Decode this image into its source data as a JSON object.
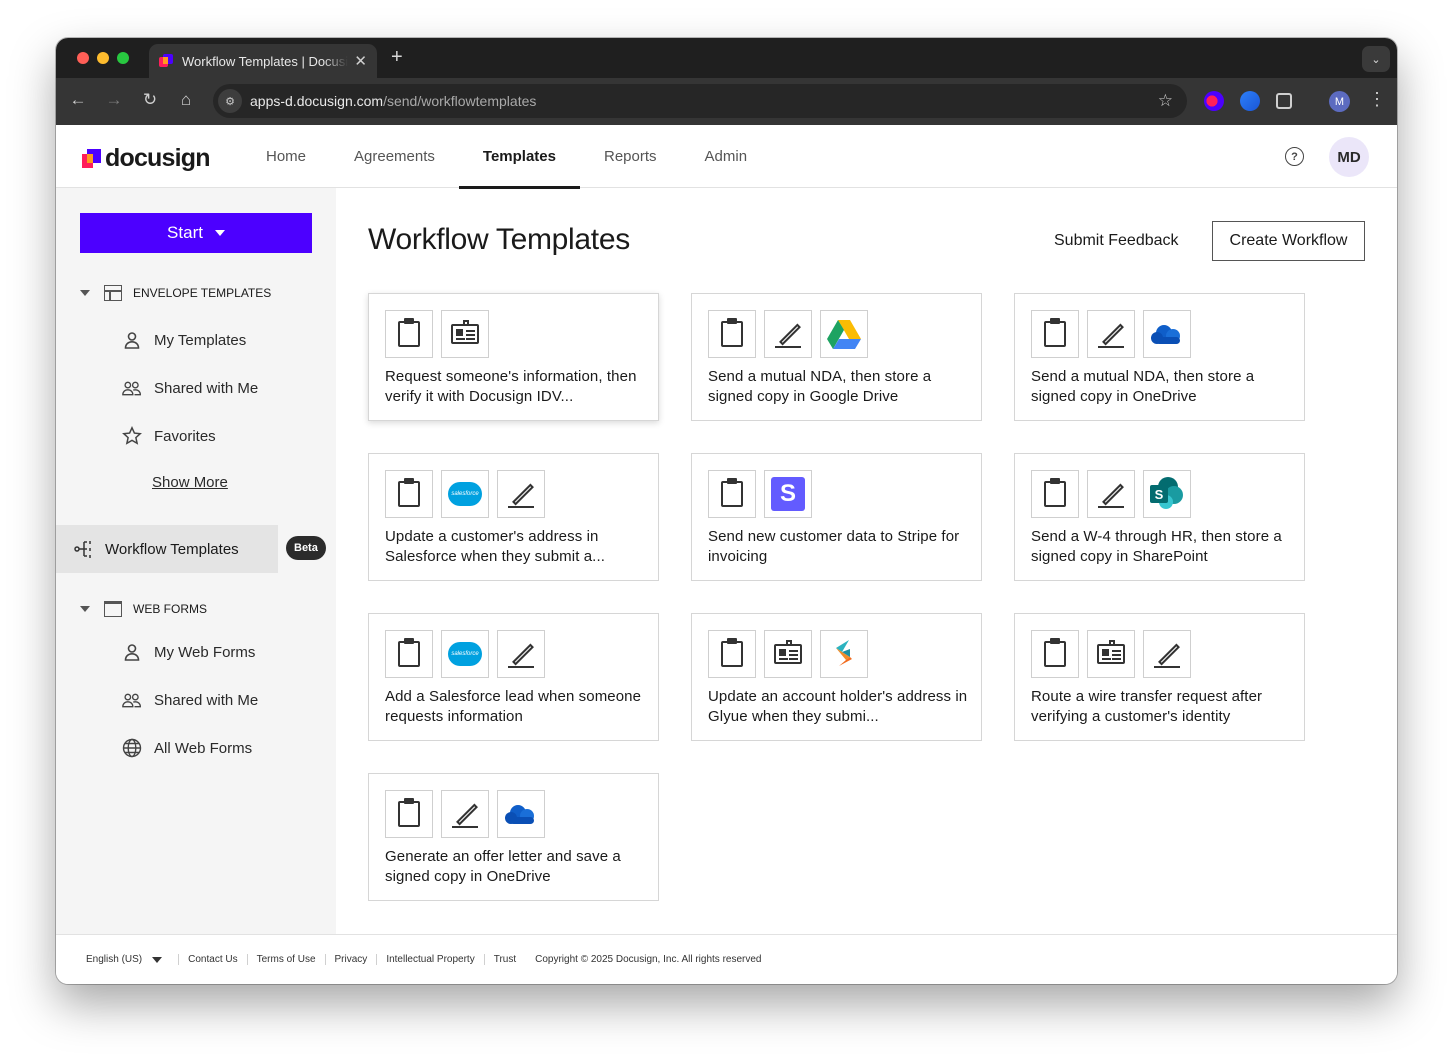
{
  "browser": {
    "tab_title": "Workflow Templates | Docusign",
    "url_domain": "apps-d.docusign.com",
    "url_path": "/send/workflowtemplates",
    "profile_initial": "M",
    "traffic_lights": [
      "#ff5f57",
      "#febc2e",
      "#28c840"
    ]
  },
  "app": {
    "logo_text": "docusign",
    "nav": [
      {
        "label": "Home",
        "active": false
      },
      {
        "label": "Agreements",
        "active": false
      },
      {
        "label": "Templates",
        "active": true
      },
      {
        "label": "Reports",
        "active": false
      },
      {
        "label": "Admin",
        "active": false
      }
    ],
    "help_icon": "?",
    "avatar_initials": "MD",
    "accent_color": "#4c00ff"
  },
  "sidebar": {
    "start_label": "Start",
    "envelope_section": "ENVELOPE TEMPLATES",
    "envelope_items": [
      "My Templates",
      "Shared with Me",
      "Favorites"
    ],
    "show_more": "Show More",
    "workflow_item": "Workflow Templates",
    "beta_badge": "Beta",
    "webforms_section": "WEB FORMS",
    "webforms_items": [
      "My Web Forms",
      "Shared with Me",
      "All Web Forms"
    ]
  },
  "main": {
    "title": "Workflow Templates",
    "feedback_label": "Submit Feedback",
    "create_label": "Create Workflow",
    "cards": [
      {
        "icons": [
          "clipboard-icon",
          "id-card-icon"
        ],
        "text": "Request someone's information, then verify it with Docusign IDV..."
      },
      {
        "icons": [
          "clipboard-icon",
          "pen-icon",
          "google-drive-icon"
        ],
        "text": "Send a mutual NDA, then store a signed copy in Google Drive"
      },
      {
        "icons": [
          "clipboard-icon",
          "pen-icon",
          "onedrive-icon"
        ],
        "text": "Send a mutual NDA, then store a signed copy in OneDrive"
      },
      {
        "icons": [
          "clipboard-icon",
          "salesforce-icon",
          "pen-icon"
        ],
        "text": "Update a customer's address in Salesforce when they submit a..."
      },
      {
        "icons": [
          "clipboard-icon",
          "stripe-icon"
        ],
        "text": "Send new customer data to Stripe for invoicing"
      },
      {
        "icons": [
          "clipboard-icon",
          "pen-icon",
          "sharepoint-icon"
        ],
        "text": "Send a W-4 through HR, then store a signed copy in SharePoint"
      },
      {
        "icons": [
          "clipboard-icon",
          "salesforce-icon",
          "pen-icon"
        ],
        "text": "Add a Salesforce lead when someone requests information"
      },
      {
        "icons": [
          "clipboard-icon",
          "id-card-icon",
          "glyue-icon"
        ],
        "text": "Update an account holder's address in Glyue when they submi..."
      },
      {
        "icons": [
          "clipboard-icon",
          "id-card-icon",
          "pen-icon"
        ],
        "text": "Route a wire transfer request after verifying a customer's identity"
      },
      {
        "icons": [
          "clipboard-icon",
          "pen-icon",
          "onedrive-icon"
        ],
        "text": "Generate an offer letter and save a signed copy in OneDrive"
      }
    ]
  },
  "footer": {
    "language": "English (US)",
    "links": [
      "Contact Us",
      "Terms of Use",
      "Privacy",
      "Intellectual Property",
      "Trust"
    ],
    "copyright": "Copyright © 2025 Docusign, Inc. All rights reserved"
  }
}
